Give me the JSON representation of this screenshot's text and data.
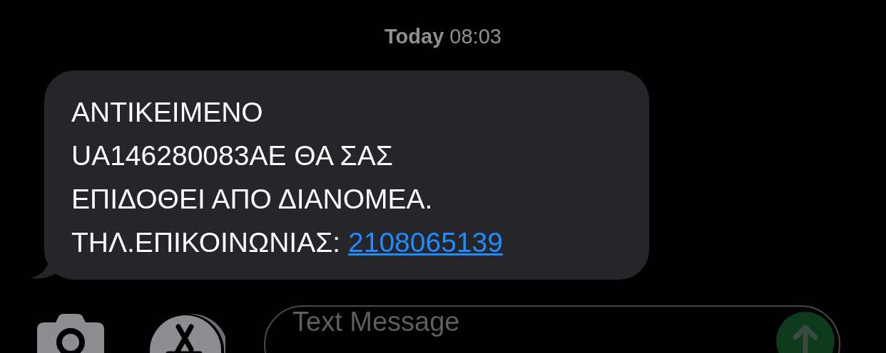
{
  "timestamp": {
    "day": "Today",
    "time": "08:03"
  },
  "message": {
    "lines": [
      "ΑΝΤΙΚΕΙΜΕΝΟ",
      "UA146280083AE ΘΑ ΣΑΣ",
      "ΕΠΙΔΟΘΕΙ ΑΠΟ ΔΙΑΝΟΜΕΑ.",
      "ΤΗΛ.ΕΠΙΚΟΙΝΩΝΙΑΣ:"
    ],
    "link": "2108065139"
  },
  "composer": {
    "placeholder": "Text Message"
  }
}
